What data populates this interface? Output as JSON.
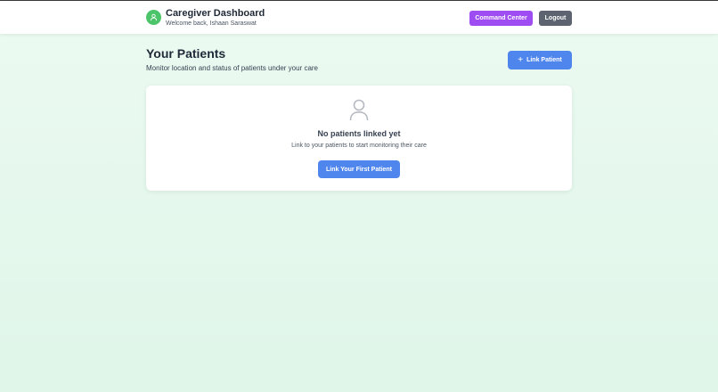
{
  "header": {
    "title": "Caregiver Dashboard",
    "subtitle": "Welcome back, Ishaan Saraswat",
    "avatar_icon": "user-icon",
    "avatar_color": "#4cc46a",
    "command_center_label": "Command Center",
    "command_center_color": "#9e4df2",
    "logout_label": "Logout",
    "logout_color": "#5d6470"
  },
  "main": {
    "title": "Your Patients",
    "subtitle": "Monitor location and status of patients under your care",
    "link_patient_icon": "plus-icon",
    "link_patient_label": "Link Patient",
    "accent_color": "#4f86ee"
  },
  "empty_state": {
    "icon": "user-icon",
    "title": "No patients linked yet",
    "message": "Link to your patients to start monitoring their care",
    "button_label": "Link Your First Patient"
  }
}
